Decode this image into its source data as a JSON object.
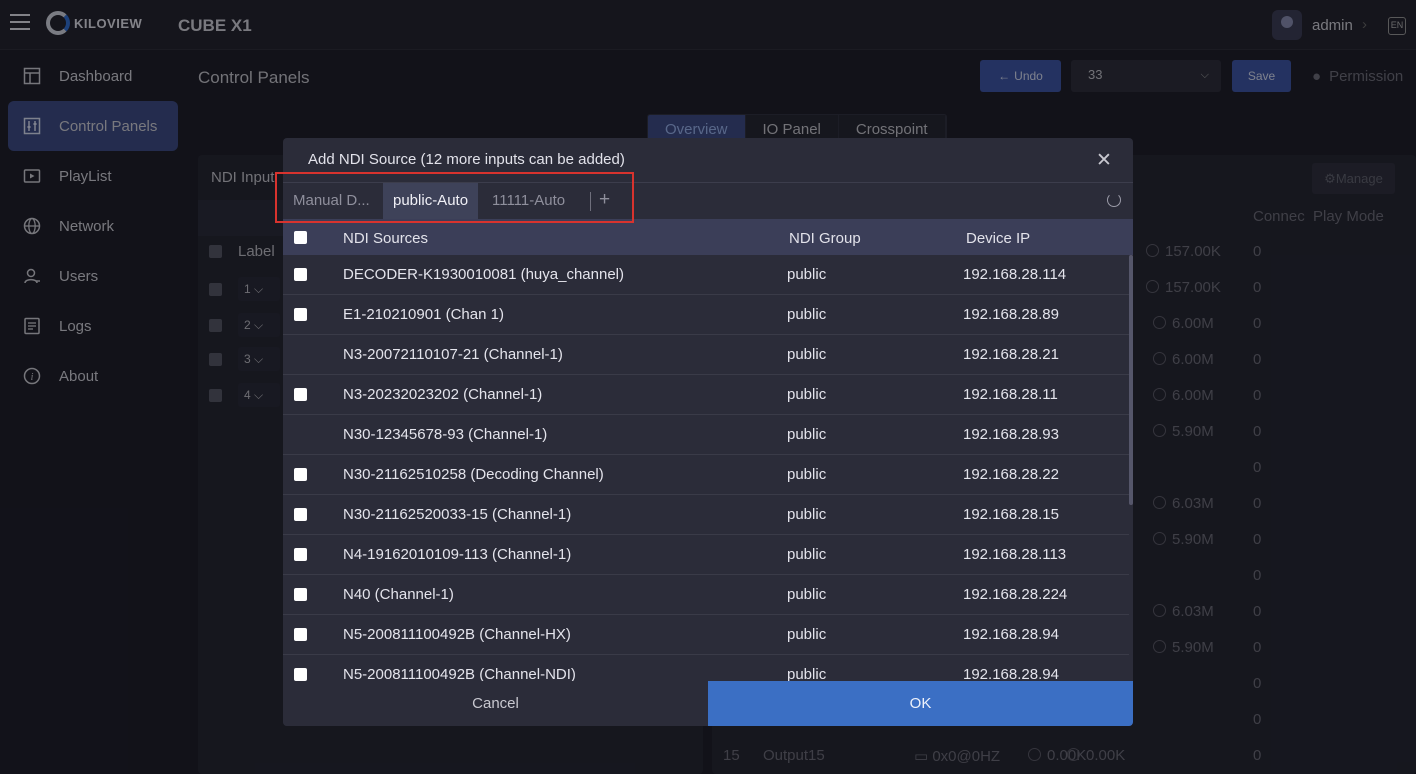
{
  "header": {
    "logo_text": "KILOVIEW",
    "device_name": "CUBE X1",
    "username": "admin",
    "lang": "EN"
  },
  "sidebar": {
    "items": [
      {
        "label": "Dashboard",
        "icon": "dashboard-icon"
      },
      {
        "label": "Control Panels",
        "icon": "sliders-icon",
        "active": true
      },
      {
        "label": "PlayList",
        "icon": "playlist-icon"
      },
      {
        "label": "Network",
        "icon": "globe-icon"
      },
      {
        "label": "Users",
        "icon": "user-icon"
      },
      {
        "label": "Logs",
        "icon": "log-icon"
      },
      {
        "label": "About",
        "icon": "info-icon"
      }
    ]
  },
  "main": {
    "title": "Control Panels",
    "undo_label": "Undo",
    "panel_select_value": "33",
    "save_label": "Save",
    "permission_label": "Permission",
    "tabs": [
      "Overview",
      "IO Panel",
      "Crosspoint"
    ],
    "left_panel_title": "NDI Input",
    "left_header_label": "Label",
    "left_rows": [
      "1",
      "2",
      "3",
      "4"
    ],
    "manage_label": "Manage",
    "right_headers": [
      "Connec",
      "Play Mode"
    ],
    "right_rates": [
      "157.00K",
      "157.00K",
      "6.00M",
      "6.00M",
      "6.00M",
      "5.90M",
      "",
      "6.03M",
      "5.90M",
      "",
      "6.03M",
      "5.90M"
    ],
    "right_connections": [
      "0",
      "0",
      "0",
      "0",
      "0",
      "0",
      "0",
      "0",
      "0",
      "0",
      "0",
      "0",
      "0",
      "0",
      "0"
    ],
    "last_row": {
      "num": "15",
      "name": "Output15",
      "res": "0x0@0HZ",
      "rate1": "0.00K",
      "rate2": "0.00K",
      "conn": "0"
    }
  },
  "modal": {
    "title": "Add NDI Source (12 more inputs can be added)",
    "tabs": [
      "Manual D...",
      "public-Auto",
      "11111-Auto"
    ],
    "active_tab": "public-Auto",
    "columns": [
      "NDI Sources",
      "NDI Group",
      "Device IP"
    ],
    "rows": [
      {
        "source": "DECODER-K1930010081 (huya_channel)",
        "group": "public",
        "ip": "192.168.28.114",
        "checkbox": true
      },
      {
        "source": "E1-210210901 (Chan 1)",
        "group": "public",
        "ip": "192.168.28.89",
        "checkbox": true
      },
      {
        "source": "N3-20072110107-21 (Channel-1)",
        "group": "public",
        "ip": "192.168.28.21",
        "checkbox": false
      },
      {
        "source": "N3-20232023202 (Channel-1)",
        "group": "public",
        "ip": "192.168.28.11",
        "checkbox": true
      },
      {
        "source": "N30-12345678-93 (Channel-1)",
        "group": "public",
        "ip": "192.168.28.93",
        "checkbox": false
      },
      {
        "source": "N30-21162510258 (Decoding Channel)",
        "group": "public",
        "ip": "192.168.28.22",
        "checkbox": true
      },
      {
        "source": "N30-21162520033-15 (Channel-1)",
        "group": "public",
        "ip": "192.168.28.15",
        "checkbox": true
      },
      {
        "source": "N4-19162010109-113 (Channel-1)",
        "group": "public",
        "ip": "192.168.28.113",
        "checkbox": true
      },
      {
        "source": "N40 (Channel-1)",
        "group": "public",
        "ip": "192.168.28.224",
        "checkbox": true
      },
      {
        "source": "N5-200811100492B (Channel-HX)",
        "group": "public",
        "ip": "192.168.28.94",
        "checkbox": true
      },
      {
        "source": "N5-200811100492B (Channel-NDI)",
        "group": "public",
        "ip": "192.168.28.94",
        "checkbox": true
      }
    ],
    "cancel_label": "Cancel",
    "ok_label": "OK"
  },
  "colors": {
    "accent": "#3b6fc4",
    "active_nav": "#3b4a86",
    "highlight": "#d8332e"
  }
}
